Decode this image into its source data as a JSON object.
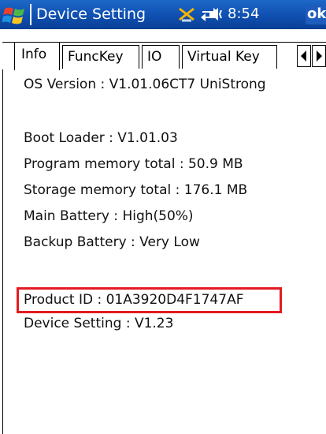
{
  "titlebar": {
    "title": "Device Setting",
    "time": "8:54",
    "ok_label": "ok",
    "icons": [
      "start-flag-icon",
      "connectivity-icon",
      "sync-icon",
      "volume-icon"
    ]
  },
  "tabs": [
    {
      "label": "Info",
      "active": true
    },
    {
      "label": "FuncKey",
      "active": false
    },
    {
      "label": "IO",
      "active": false
    },
    {
      "label": "Virtual Key",
      "active": false
    }
  ],
  "info": {
    "os_version": "OS Version : V1.01.06CT7 UniStrong",
    "boot_loader": "Boot Loader : V1.01.03",
    "program_memory": "Program memory total : 50.9 MB",
    "storage_memory": "Storage memory total : 176.1 MB",
    "main_battery": "Main Battery : High(50%)",
    "backup_battery": "Backup Battery : Very Low",
    "product_id": "Product ID : 01A3920D4F1747AF",
    "device_setting": "Device Setting : V1.23"
  },
  "colors": {
    "titlebar": "#0f4fb0",
    "highlight": "#e41a22"
  }
}
